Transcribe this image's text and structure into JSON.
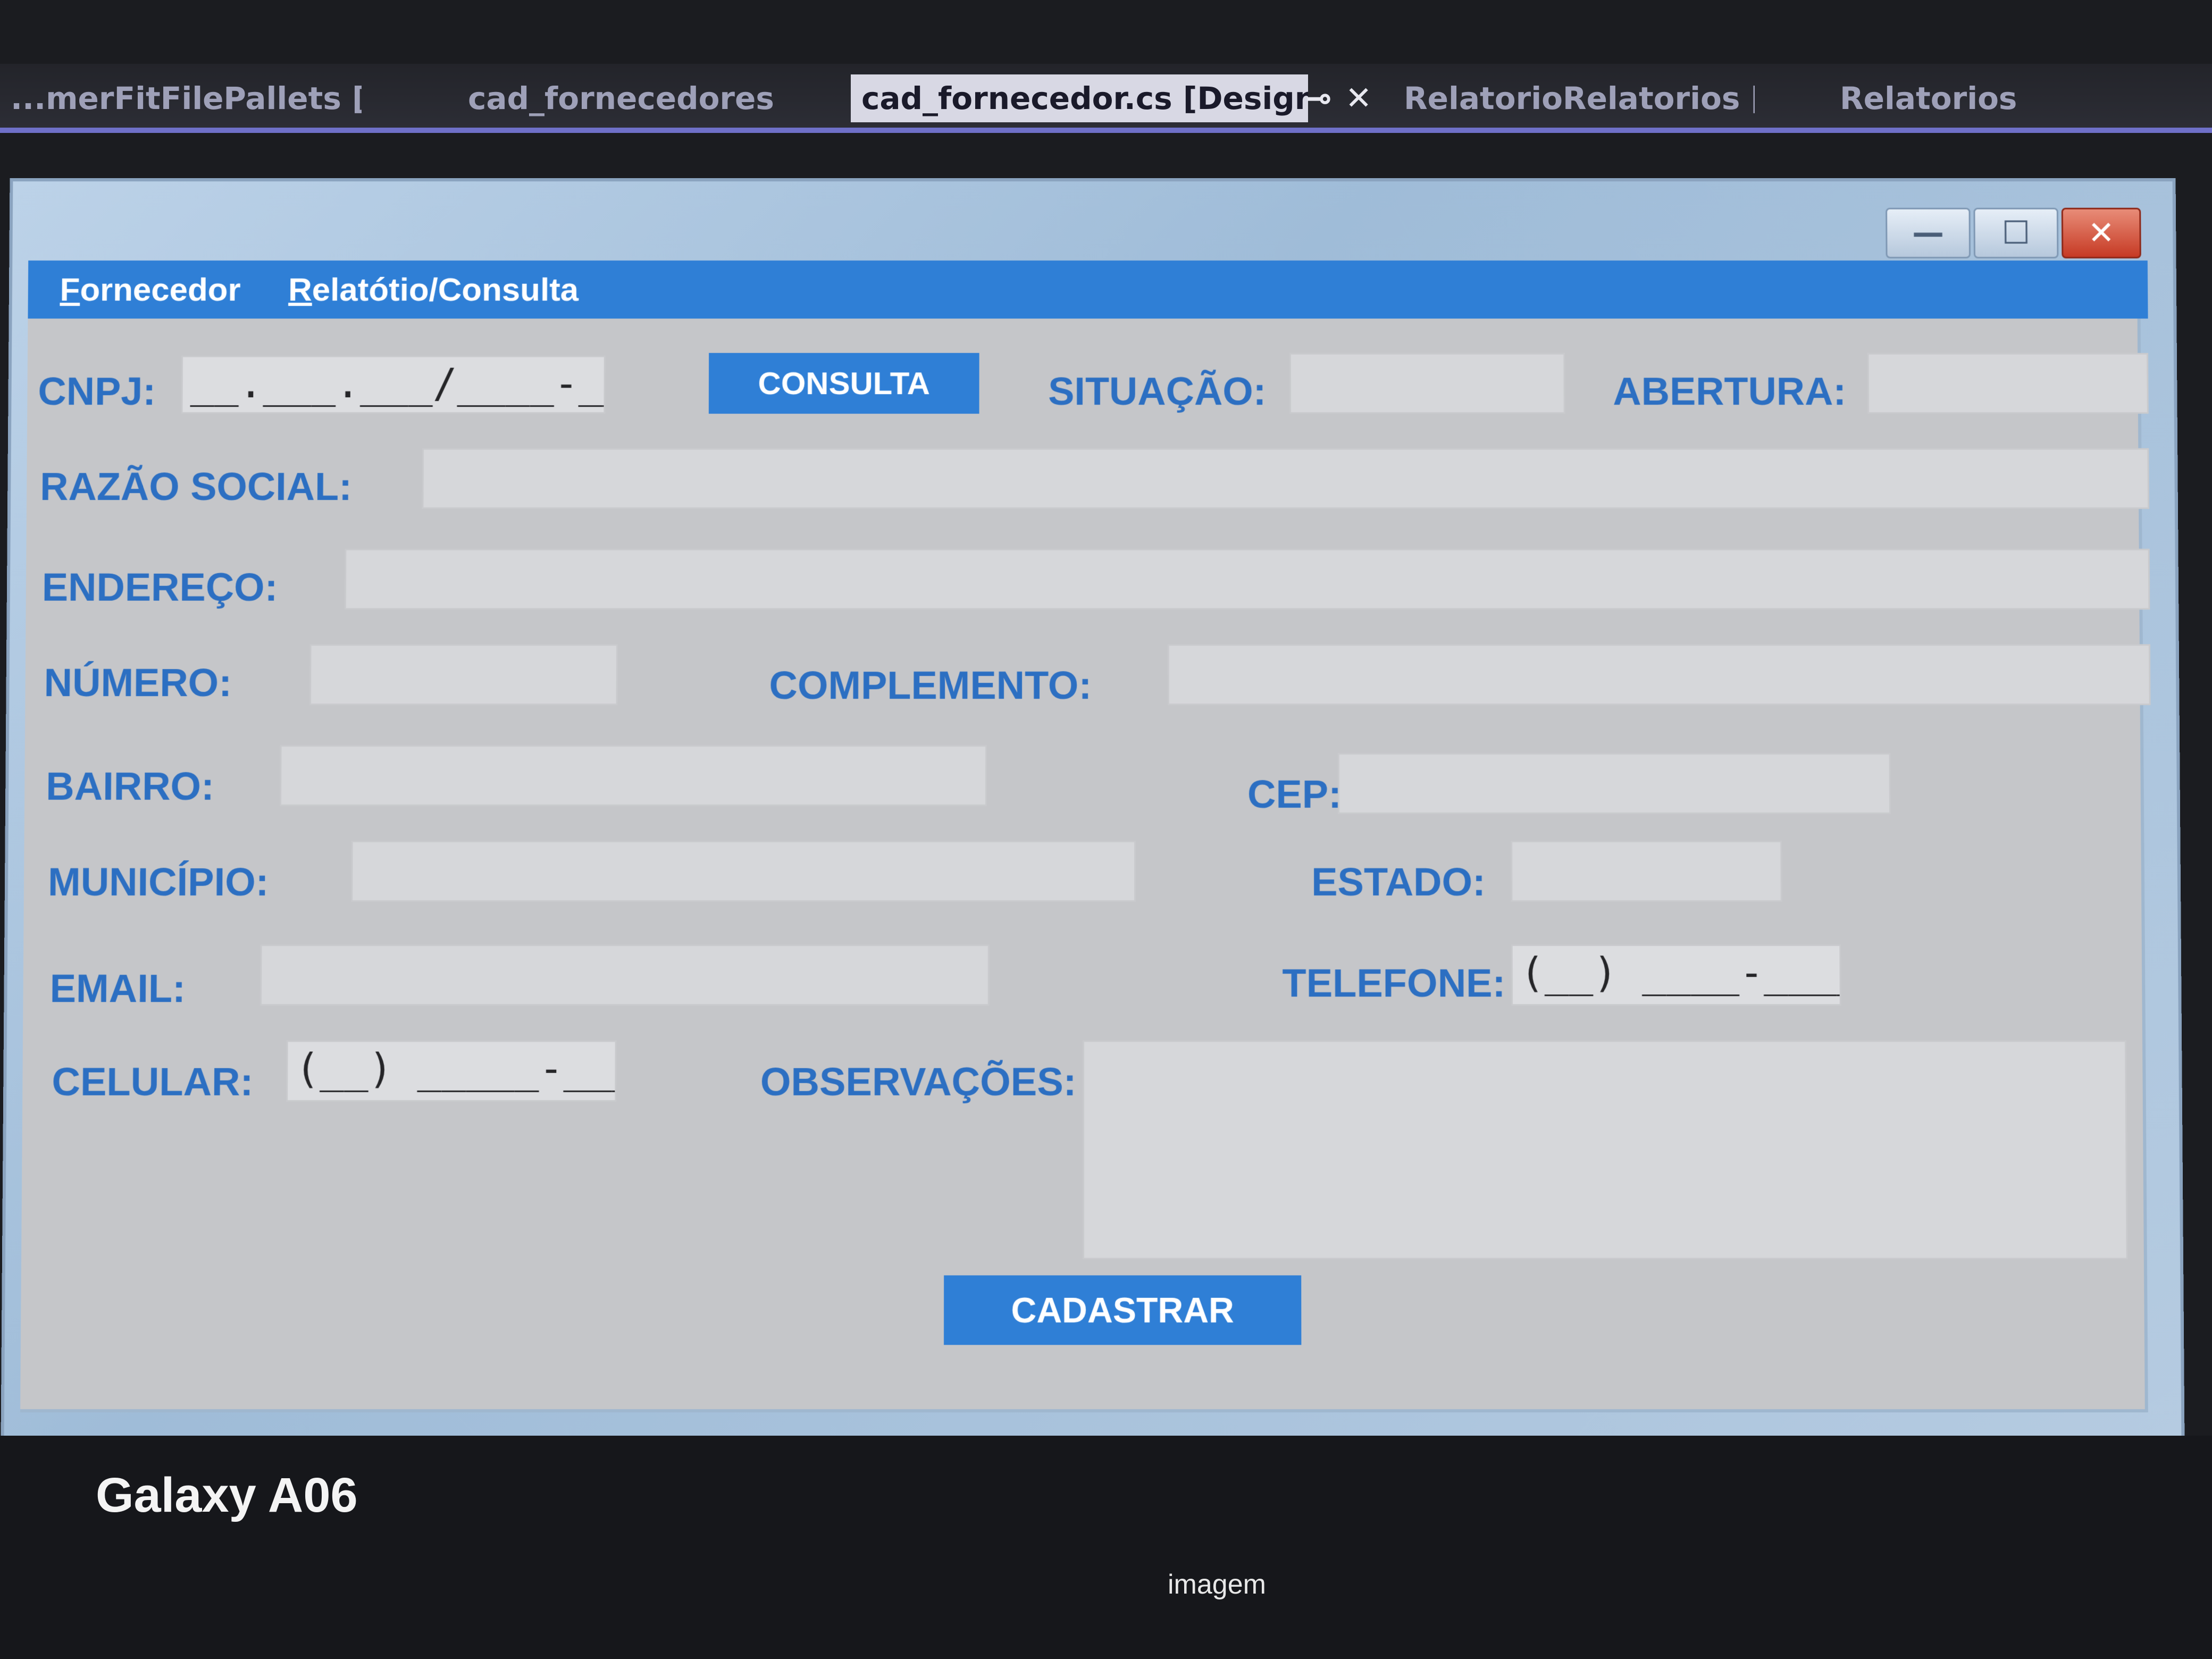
{
  "ide_tabs": [
    {
      "label": "...merFitFilePallets [Design]",
      "active": false
    },
    {
      "label": "cad_fornecedores",
      "active": false
    },
    {
      "label": "cad_fornecedor.cs [Design]",
      "active": true
    },
    {
      "label": "RelatorioRelatorios [Design]",
      "active": false
    },
    {
      "label": "Relatorios",
      "active": false
    }
  ],
  "window": {
    "controls": {
      "minimize": "—",
      "maximize": "☐",
      "close": "✕"
    }
  },
  "menu": {
    "items": [
      "Fornecedor",
      "Relatótio/Consulta"
    ]
  },
  "form": {
    "cnpj_label": "CNPJ:",
    "cnpj_mask": "__.___.___/____-__",
    "consulta_button": "CONSULTA",
    "situacao_label": "SITUAÇÃO:",
    "abertura_label": "ABERTURA:",
    "razao_label": "RAZÃO SOCIAL:",
    "endereco_label": "ENDEREÇO:",
    "numero_label": "NÚMERO:",
    "complemento_label": "COMPLEMENTO:",
    "bairro_label": "BAIRRO:",
    "cep_label": "CEP:",
    "municipio_label": "MUNICÍPIO:",
    "estado_label": "ESTADO:",
    "email_label": "EMAIL:",
    "telefone_label": "TELEFONE:",
    "telefone_mask": "(__) ____-____",
    "celular_label": "CELULAR:",
    "celular_mask": "(__) _____-____",
    "observacoes_label": "OBSERVAÇÕES:",
    "cadastrar_button": "CADASTRAR"
  },
  "photo_overlay": {
    "device": "Galaxy A06",
    "caption": "imagem"
  },
  "colors": {
    "accent": "#2f7fd6",
    "label": "#2c6fc2",
    "client_bg": "#c5c6c9",
    "field_bg": "#d6d7da"
  }
}
